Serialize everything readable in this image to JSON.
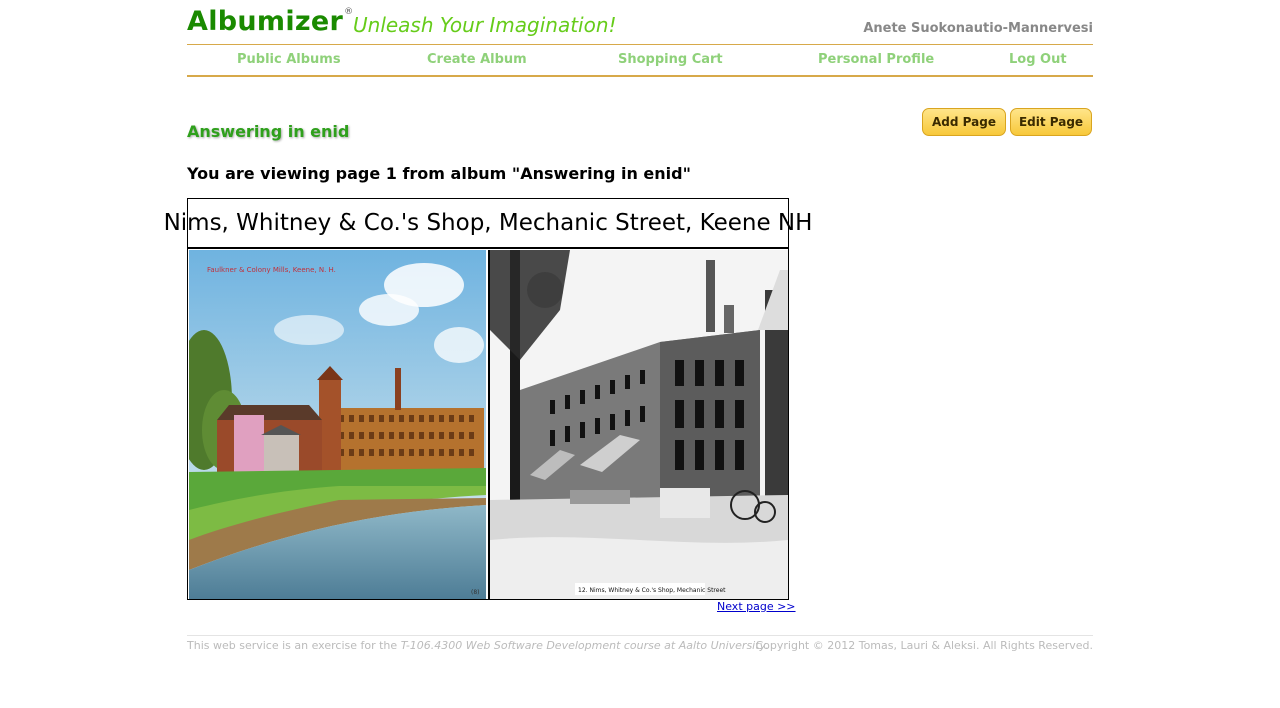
{
  "brand": {
    "name": "Albumizer",
    "reg_mark": "®",
    "tagline": "Unleash Your Imagination!"
  },
  "user": {
    "name": "Anete Suokonautio-Mannervesi"
  },
  "nav": {
    "items": [
      {
        "label": "Public Albums"
      },
      {
        "label": "Create Album"
      },
      {
        "label": "Shopping Cart"
      },
      {
        "label": "Personal Profile"
      },
      {
        "label": "Log Out"
      }
    ]
  },
  "album": {
    "title": "Answering in enid"
  },
  "buttons": {
    "add_page": "Add Page",
    "edit_page": "Edit Page"
  },
  "viewing_text": "You are viewing page 1 from album \"Answering in enid\"",
  "page": {
    "caption": "Nims, Whitney & Co.'s Shop, Mechanic Street, Keene NH",
    "left_photo_inscription": "Faulkner & Colony Mills, Keene, N. H.",
    "right_photo_inscription": "12. Nims, Whitney & Co.'s Shop, Mechanic Street",
    "left_photo_corner": "(8)"
  },
  "next_link": "Next page >>",
  "footer": {
    "left_prefix": "This web service is an exercise for the ",
    "left_course": "T-106.4300 Web Software Development course at ",
    "left_university": "Aalto University",
    "left_suffix": ".",
    "right": "Copyright © 2012 Tomas, Lauri & Aleksi. All Rights Reserved."
  },
  "colors": {
    "brand_green": "#1a8a00",
    "tagline_green": "#66cc1a",
    "nav_text": "#8fd17a",
    "nav_border": "#d7a94a",
    "button_yellow": "#f7c83a",
    "link_blue": "#0000cc"
  }
}
